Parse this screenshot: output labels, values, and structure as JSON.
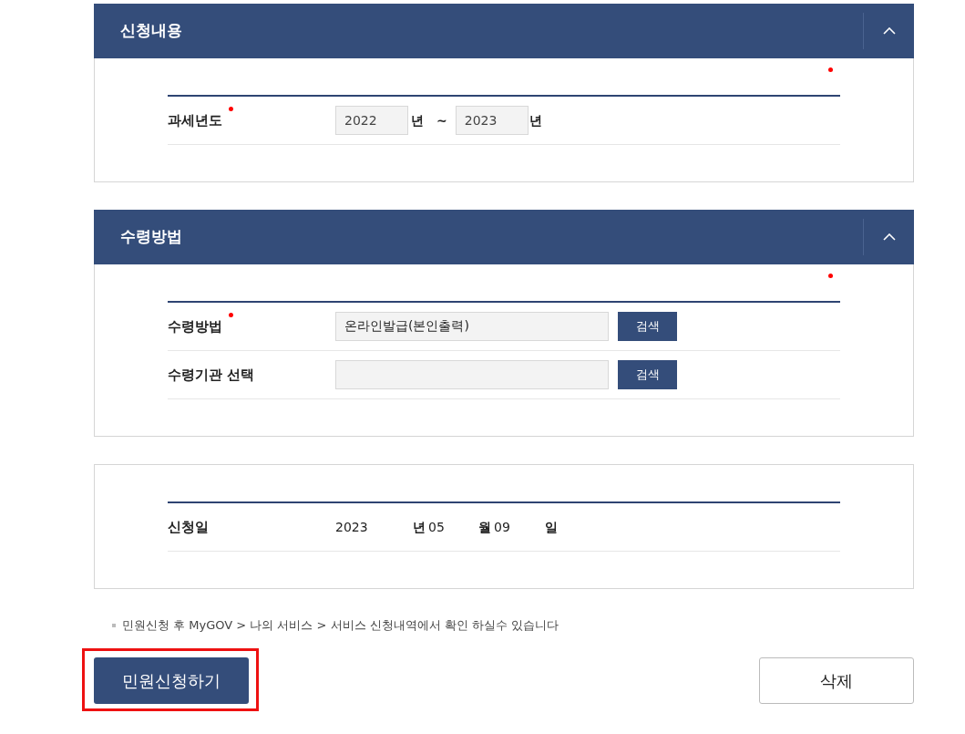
{
  "sections": [
    {
      "title": "신청내용",
      "expanded": true,
      "required_legend": true,
      "rows": [
        {
          "kind": "year_range",
          "label": "과세년도",
          "required": true,
          "from": "2022",
          "from_unit": "년",
          "separator": "~",
          "to": "2023",
          "to_unit": "년"
        }
      ]
    },
    {
      "title": "수령방법",
      "expanded": true,
      "required_legend": true,
      "rows": [
        {
          "kind": "input_search",
          "label": "수령방법",
          "required": true,
          "value": "온라인발급(본인출력)",
          "button": "검색"
        },
        {
          "kind": "input_search",
          "label": "수령기관 선택",
          "required": false,
          "button": "검색"
        }
      ]
    },
    {
      "required_legend": false,
      "rows": [
        {
          "kind": "date",
          "label": "신청일",
          "required": false,
          "parts": [
            "2023",
            "년",
            "05",
            "월",
            "09",
            "일"
          ]
        }
      ]
    }
  ],
  "note": "민원신청 후 MyGOV > 나의 서비스 > 서비스 신청내역에서 확인 하실수 있습니다",
  "submit_button": {
    "label": "민원신청하기",
    "highlighted": true
  },
  "delete_button": {
    "label": "삭제"
  }
}
